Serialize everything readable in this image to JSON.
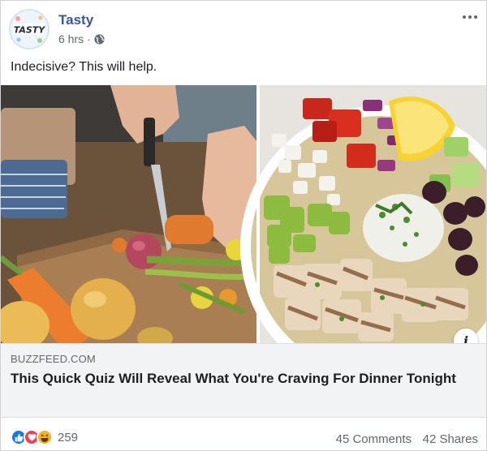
{
  "post": {
    "page_name": "Tasty",
    "avatar_text": "TASTY",
    "time": "6 hrs",
    "separator": "·",
    "privacy_icon": "globe-icon",
    "message": "Indecisive? This will help."
  },
  "link": {
    "domain": "BUZZFEED.COM",
    "title": "This Quick Quiz Will Reveal What You're Craving For Dinner Tonight",
    "info_icon_glyph": "i"
  },
  "footer": {
    "reactions": [
      "like-icon",
      "love-icon",
      "haha-icon"
    ],
    "reaction_count": "259",
    "comments": "45 Comments",
    "shares": "42 Shares"
  },
  "colors": {
    "page_name": "#385898",
    "like": "#1877f2",
    "love": "#f33e58",
    "haha": "#f7b125",
    "link_box_bg": "#f2f3f5"
  }
}
